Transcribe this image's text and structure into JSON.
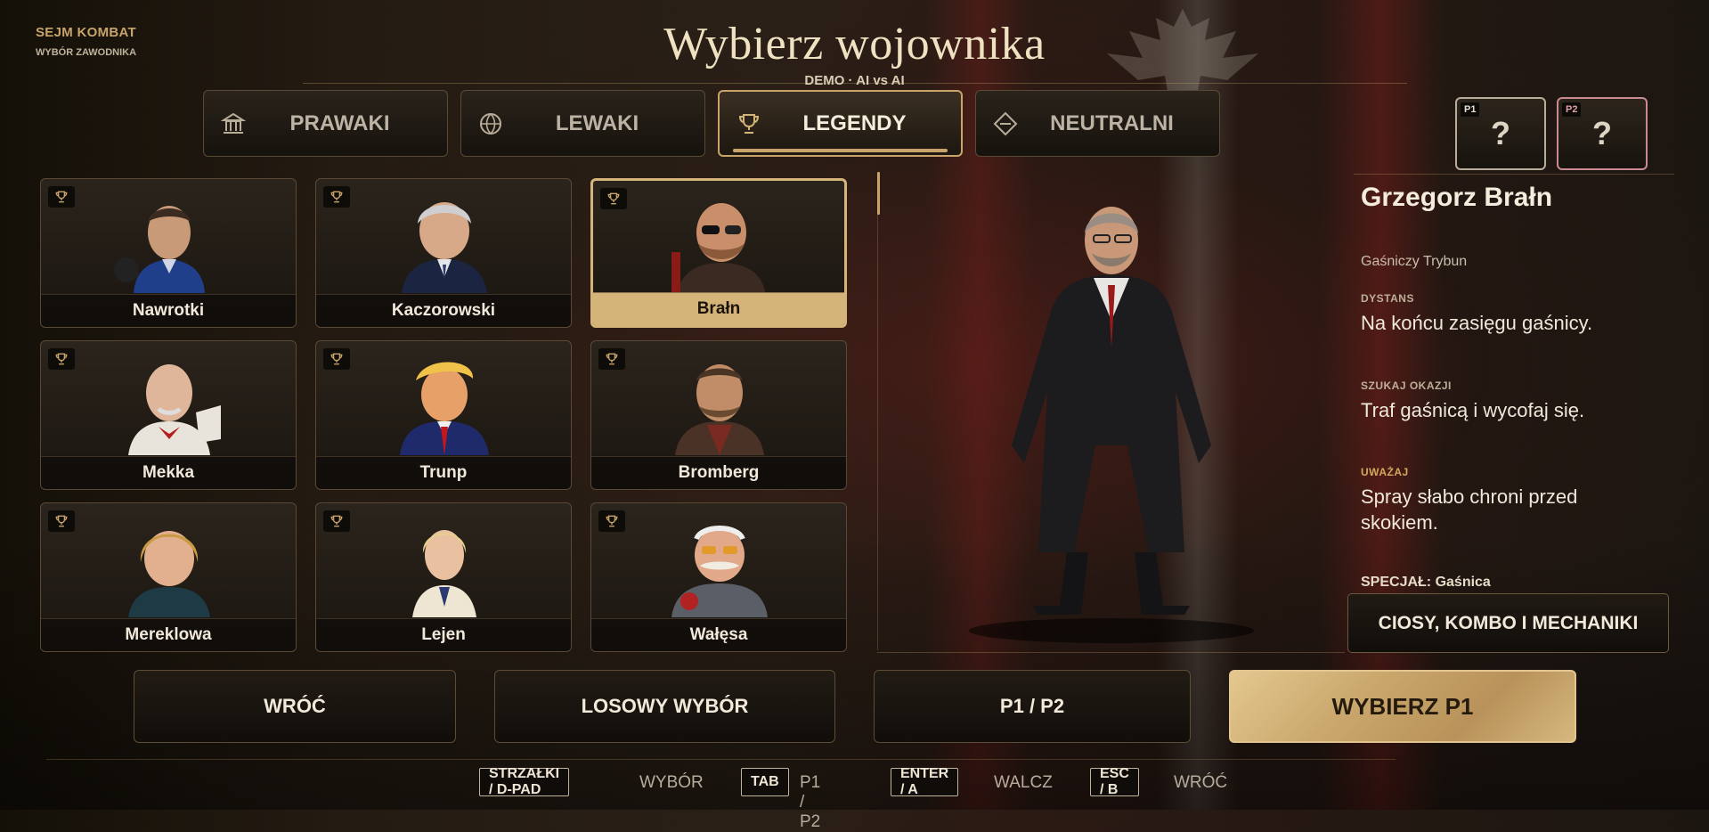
{
  "brand": {
    "title": "SEJM KOMBAT",
    "subtitle": "WYBÓR ZAWODNIKA"
  },
  "header": {
    "title": "Wybierz wojownika",
    "mode": "DEMO · AI vs AI"
  },
  "tabs": [
    {
      "label": "PRAWAKI",
      "icon": "building-columns-icon",
      "active": false
    },
    {
      "label": "LEWAKI",
      "icon": "globe-icon",
      "active": false
    },
    {
      "label": "LEGENDY",
      "icon": "trophy-icon",
      "active": true
    },
    {
      "label": "NEUTRALNI",
      "icon": "diamond-icon",
      "active": false
    }
  ],
  "slots": [
    {
      "tag": "P1",
      "value": "?"
    },
    {
      "tag": "P2",
      "value": "?"
    }
  ],
  "fighters": [
    {
      "name": "Nawrotki",
      "selected": false
    },
    {
      "name": "Kaczorowski",
      "selected": false
    },
    {
      "name": "Brałn",
      "selected": true
    },
    {
      "name": "Mekka",
      "selected": false
    },
    {
      "name": "Trunp",
      "selected": false
    },
    {
      "name": "Bromberg",
      "selected": false
    },
    {
      "name": "Mereklowa",
      "selected": false
    },
    {
      "name": "Lejen",
      "selected": false
    },
    {
      "name": "Wałęsa",
      "selected": false
    }
  ],
  "details": {
    "name": "Grzegorz Brałn",
    "subtitle": "Gaśniczy Trybun",
    "range_label": "DYSTANS",
    "range_text": "Na końcu zasięgu gaśnicy.",
    "opportunity_label": "SZUKAJ OKAZJI",
    "opportunity_text": "Traf gaśnicą i wycofaj się.",
    "warning_label": "UWAŻAJ",
    "warning_text": "Spray słabo chroni przed skokiem.",
    "special": "SPECJAŁ: Gaśnica",
    "mechanics_button": "CIOSY, KOMBO I MECHANIKI"
  },
  "actions": {
    "back": "WRÓĆ",
    "random": "LOSOWY WYBÓR",
    "switch": "P1 / P2",
    "confirm": "WYBIERZ P1"
  },
  "hints": [
    {
      "key": "STRZAŁKI / D-PAD",
      "action": "WYBÓR"
    },
    {
      "key": "TAB",
      "action": "P1 / P2"
    },
    {
      "key": "ENTER / A",
      "action": "WALCZ"
    },
    {
      "key": "ESC / B",
      "action": "WRÓĆ"
    }
  ],
  "colors": {
    "accent": "#c9a46a",
    "primary_button": "#d6b87e",
    "p2": "#c98a92"
  }
}
